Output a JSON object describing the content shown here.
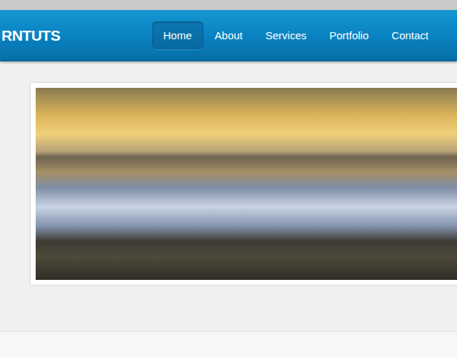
{
  "header": {
    "logo": "RNTUTS"
  },
  "nav": [
    {
      "label": "Home",
      "selected": true
    },
    {
      "label": "About",
      "selected": false
    },
    {
      "label": "Services",
      "selected": false
    },
    {
      "label": "Portfolio",
      "selected": false
    },
    {
      "label": "Contact",
      "selected": false
    }
  ]
}
